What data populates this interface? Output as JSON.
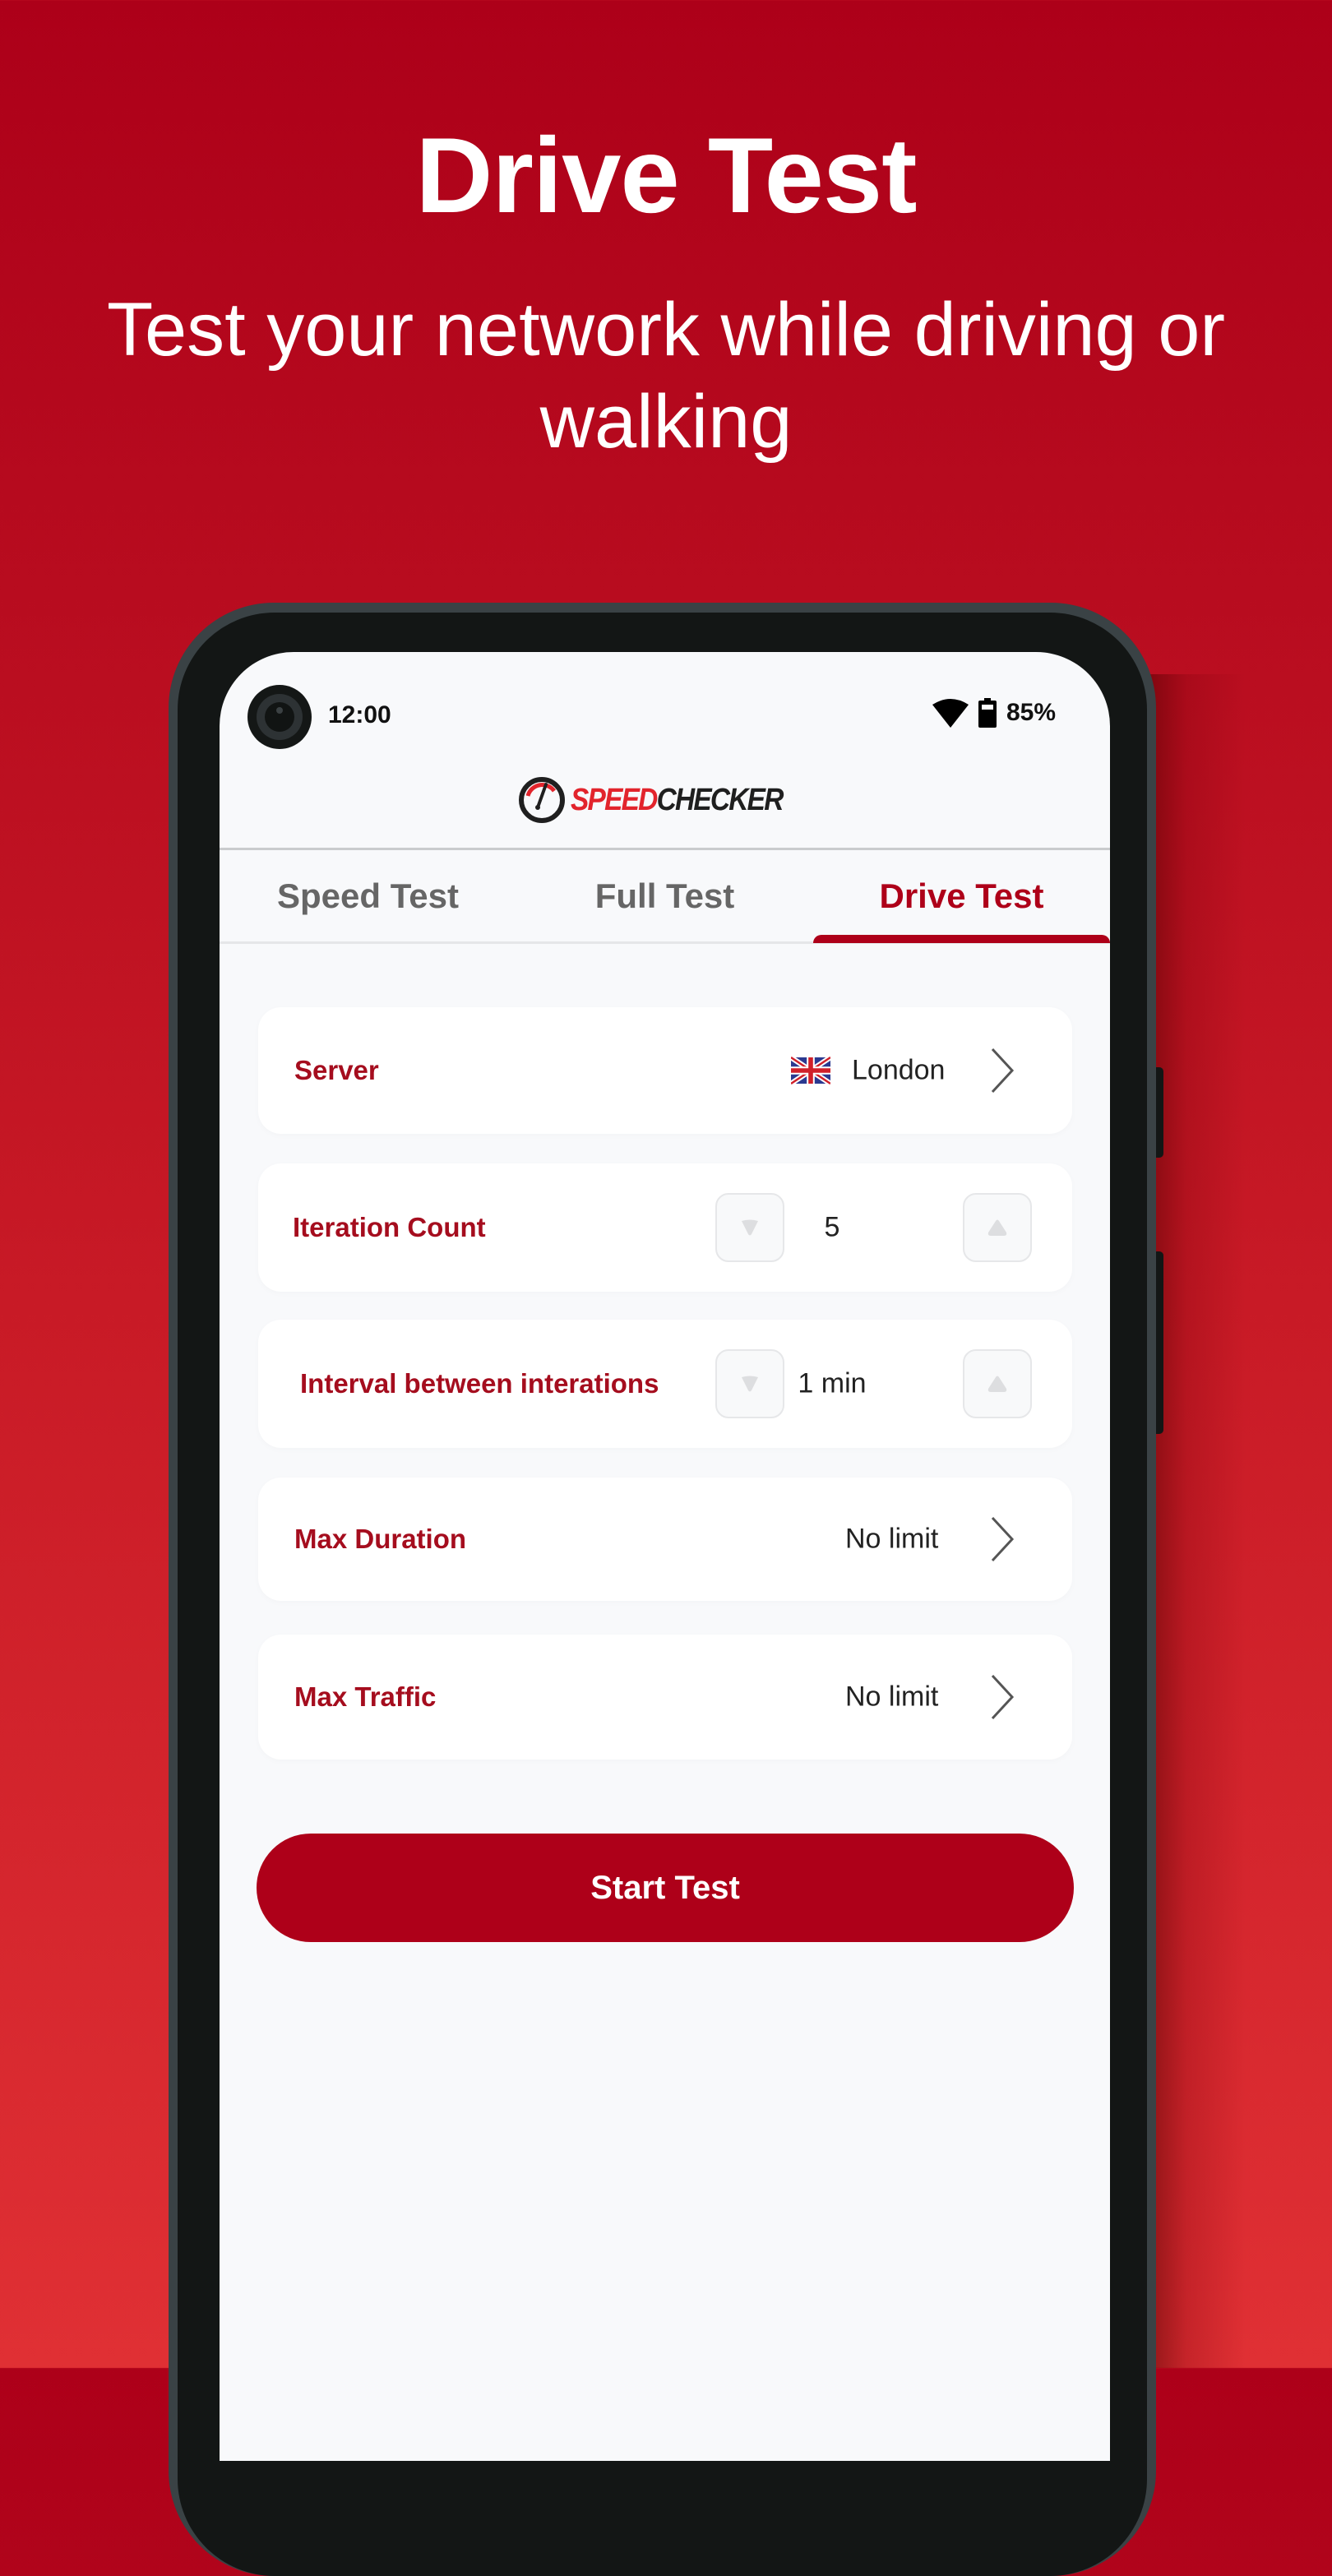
{
  "hero": {
    "title": "Drive Test",
    "subtitle": "Test your network while driving or walking"
  },
  "status_bar": {
    "time": "12:00",
    "battery_percent": "85%",
    "icons": [
      "camera-cutout",
      "wifi-icon",
      "battery-icon"
    ]
  },
  "app": {
    "logo": {
      "part1": "SPEED",
      "part2": "CHECKER",
      "icon": "speedometer-icon"
    },
    "tabs": [
      {
        "label": "Speed Test",
        "active": false
      },
      {
        "label": "Full Test",
        "active": false
      },
      {
        "label": "Drive Test",
        "active": true
      }
    ],
    "settings": {
      "server": {
        "label": "Server",
        "value": "London",
        "flag": "uk-flag-icon"
      },
      "iteration_count": {
        "label": "Iteration Count",
        "value": "5"
      },
      "interval": {
        "label": "Interval between interations",
        "value": "1 min"
      },
      "max_duration": {
        "label": "Max Duration",
        "value": "No limit"
      },
      "max_traffic": {
        "label": "Max Traffic",
        "value": "No limit"
      }
    },
    "start_button": "Start Test"
  },
  "colors": {
    "brand_red": "#AE0019",
    "label_red": "#A50D1E",
    "logo_red": "#E2242C",
    "background_top": "#AD0019",
    "background_bottom": "#E03034"
  }
}
